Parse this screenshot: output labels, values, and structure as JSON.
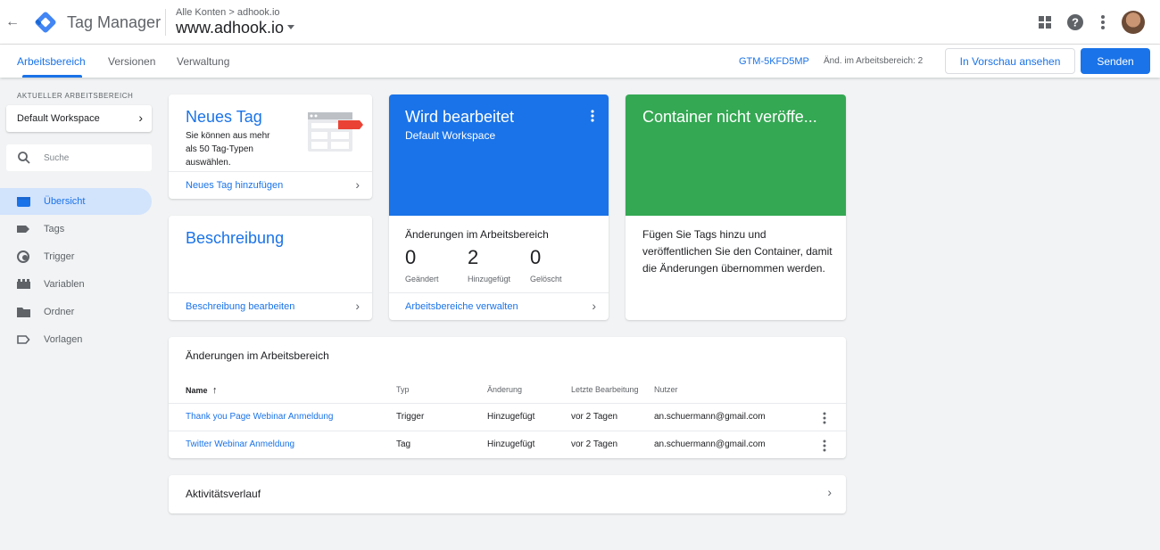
{
  "header": {
    "app_name": "Tag Manager",
    "breadcrumb_account": "Alle Konten",
    "breadcrumb_sep": ">",
    "breadcrumb_container": "adhook.io",
    "container_name": "www.adhook.io",
    "back_icon": "arrow-back-icon",
    "icons": [
      "apps-grid-icon",
      "help-icon",
      "more-vert-icon",
      "avatar"
    ]
  },
  "tabs": {
    "items": [
      {
        "label": "Arbeitsbereich",
        "active": true
      },
      {
        "label": "Versionen",
        "active": false
      },
      {
        "label": "Verwaltung",
        "active": false
      }
    ],
    "gtm_id": "GTM-5KFD5MP",
    "workspace_changes": "Änd. im Arbeitsbereich: 2",
    "preview_label": "In Vorschau ansehen",
    "send_label": "Senden"
  },
  "sidebar": {
    "workspace_label": "AKTUELLER ARBEITSBEREICH",
    "workspace_name": "Default Workspace",
    "search_placeholder": "Suche",
    "items": [
      {
        "label": "Übersicht",
        "icon": "overview-icon",
        "active": true
      },
      {
        "label": "Tags",
        "icon": "tag-icon",
        "active": false
      },
      {
        "label": "Trigger",
        "icon": "trigger-icon",
        "active": false
      },
      {
        "label": "Variablen",
        "icon": "variables-icon",
        "active": false
      },
      {
        "label": "Ordner",
        "icon": "folder-icon",
        "active": false
      },
      {
        "label": "Vorlagen",
        "icon": "template-icon",
        "active": false
      }
    ]
  },
  "cards": {
    "new_tag": {
      "title": "Neues Tag",
      "description": "Sie können aus mehr als 50 Tag-Typen auswählen.",
      "link": "Neues Tag hinzufügen"
    },
    "description": {
      "title": "Beschreibung",
      "link": "Beschreibung bearbeiten"
    },
    "editing": {
      "title": "Wird bearbeitet",
      "subtitle": "Default Workspace",
      "changes_heading": "Änderungen im Arbeitsbereich",
      "stats": [
        {
          "value": "0",
          "label": "Geändert"
        },
        {
          "value": "2",
          "label": "Hinzugefügt"
        },
        {
          "value": "0",
          "label": "Gelöscht"
        }
      ],
      "link": "Arbeitsbereiche verwalten"
    },
    "unpublished": {
      "title": "Container nicht veröffe...",
      "body": "Fügen Sie Tags hinzu und veröffentlichen Sie den Container, damit die Änderungen übernommen werden."
    }
  },
  "changes_table": {
    "title": "Änderungen im Arbeitsbereich",
    "columns": [
      "Name",
      "Typ",
      "Änderung",
      "Letzte Bearbeitung",
      "Nutzer"
    ],
    "rows": [
      {
        "name": "Thank you Page Webinar Anmeldung",
        "type": "Trigger",
        "change": "Hinzugefügt",
        "last_edit": "vor 2 Tagen",
        "user": "an.schuermann@gmail.com"
      },
      {
        "name": "Twitter Webinar Anmeldung",
        "type": "Tag",
        "change": "Hinzugefügt",
        "last_edit": "vor 2 Tagen",
        "user": "an.schuermann@gmail.com"
      }
    ]
  },
  "activity": {
    "title": "Aktivitätsverlauf"
  },
  "colors": {
    "accent": "#1a73e8",
    "editing_card": "#1a73e8",
    "unpublished_card": "#34a853",
    "background": "#f1f3f4"
  }
}
